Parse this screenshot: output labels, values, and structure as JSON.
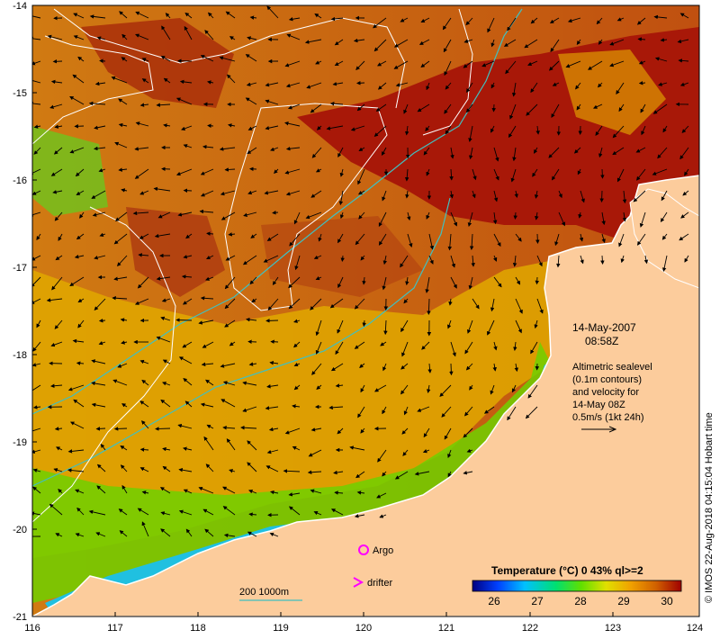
{
  "map": {
    "lon_range": [
      116,
      124
    ],
    "lat_range": [
      -21,
      -14
    ],
    "x_ticks": [
      "116",
      "117",
      "118",
      "119",
      "120",
      "121",
      "122",
      "123",
      "124"
    ],
    "y_ticks": [
      "-14",
      "-15",
      "-16",
      "-17",
      "-18",
      "-19",
      "-20",
      "-21"
    ],
    "land_color": "#fccc9c",
    "contour_color": "#ffffff",
    "isobath_color": "#40c0c0"
  },
  "annotation": {
    "date": "14-May-2007",
    "time": "08:58Z",
    "alt_line1": "Altimetric sealevel",
    "alt_line2": "(0.1m contours)",
    "alt_line3": "and velocity for",
    "alt_line4": "14-May 08Z",
    "alt_line5": "0.5m/s (1kt 24h)"
  },
  "legend": {
    "argo_label": "Argo",
    "drifter_label": "drifter",
    "argo_color": "#ff00ff",
    "drifter_color": "#ff00ff",
    "scale_label": "200  1000m"
  },
  "colorbar": {
    "title": "Temperature (°C) 0 43% ql>=2",
    "ticks": [
      "26",
      "27",
      "28",
      "29",
      "30"
    ],
    "colors": [
      "#000080",
      "#0040ff",
      "#00c0ff",
      "#00e070",
      "#60e000",
      "#e0e000",
      "#f0a000",
      "#d06000",
      "#a00000"
    ]
  },
  "credit": "© IMOS 22-Aug-2018 04:15:04 Hobart time"
}
